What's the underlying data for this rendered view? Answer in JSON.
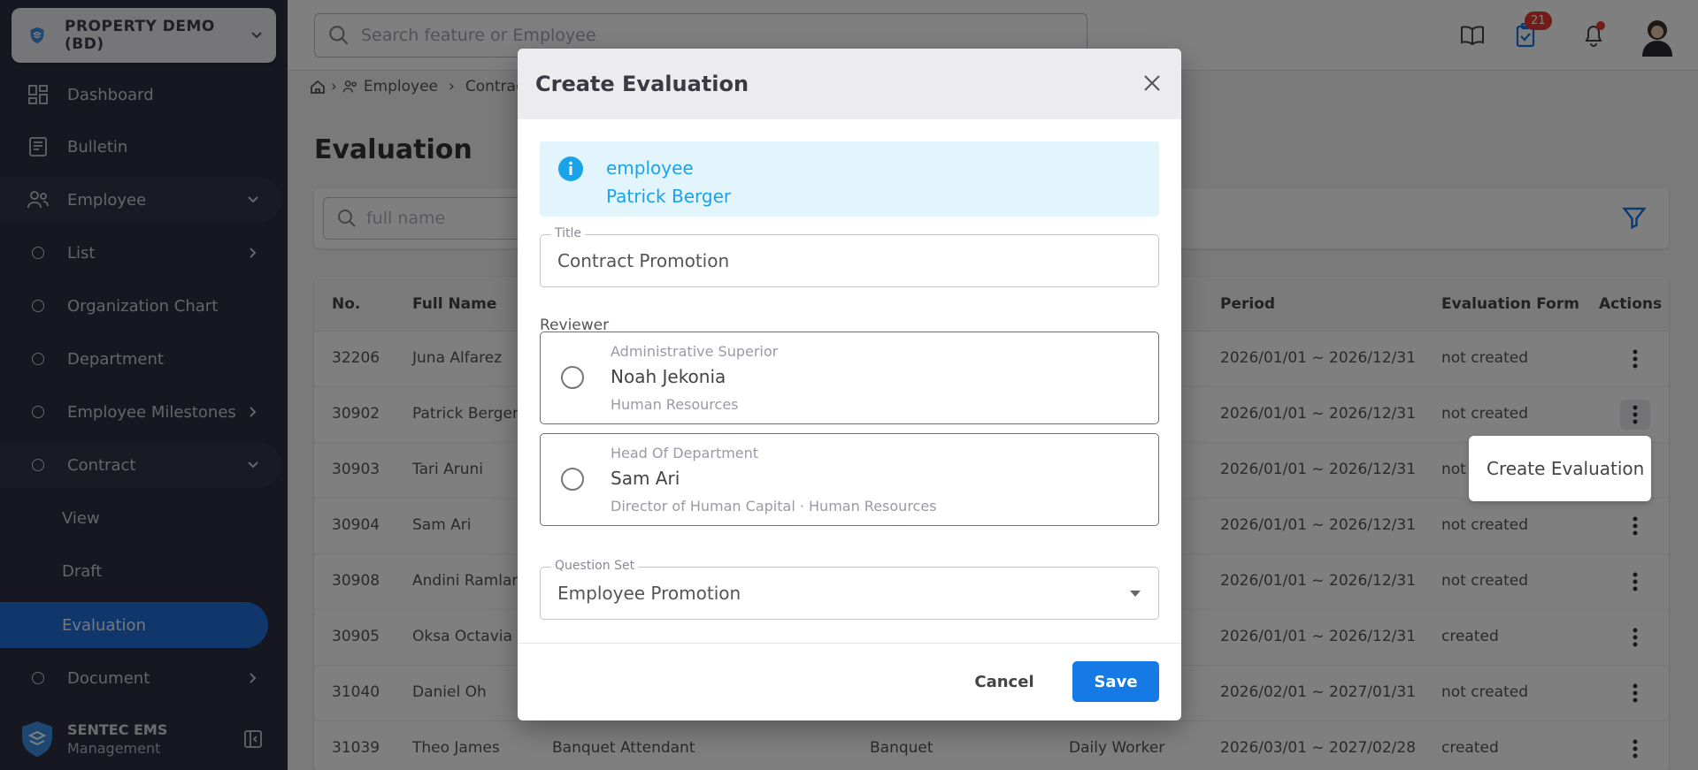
{
  "sidebar": {
    "company": "PROPERTY DEMO (BD)",
    "items": [
      {
        "label": "Dashboard"
      },
      {
        "label": "Bulletin"
      },
      {
        "label": "Employee"
      },
      {
        "label": "List"
      },
      {
        "label": "Organization Chart"
      },
      {
        "label": "Department"
      },
      {
        "label": "Employee Milestones"
      },
      {
        "label": "Contract"
      },
      {
        "label": "View"
      },
      {
        "label": "Draft"
      },
      {
        "label": "Evaluation"
      },
      {
        "label": "Document"
      }
    ],
    "brand_name": "SENTEC EMS",
    "brand_sub": "Management"
  },
  "topbar": {
    "search_placeholder": "Search feature or Employee",
    "task_badge": "21"
  },
  "breadcrumb": [
    "Employee",
    "Contract"
  ],
  "page": {
    "title": "Evaluation",
    "filter_placeholder": "full name"
  },
  "table": {
    "columns": {
      "no": "No.",
      "full_name": "Full Name",
      "period": "Period",
      "form": "Evaluation Form",
      "actions": "Actions"
    },
    "rows": [
      {
        "no": "32206",
        "name": "Juna Alfarez",
        "position": "",
        "dept": "",
        "type": "",
        "period": "2026/01/01 ~ 2026/12/31",
        "form": "not created"
      },
      {
        "no": "30902",
        "name": "Patrick Berger",
        "position": "",
        "dept": "",
        "type": "",
        "period": "2026/01/01 ~ 2026/12/31",
        "form": "not created"
      },
      {
        "no": "30903",
        "name": "Tari Aruni",
        "position": "",
        "dept": "",
        "type": "",
        "period": "2026/01/01 ~ 2026/12/31",
        "form": "not"
      },
      {
        "no": "30904",
        "name": "Sam Ari",
        "position": "",
        "dept": "",
        "type": "",
        "period": "2026/01/01 ~ 2026/12/31",
        "form": "not created"
      },
      {
        "no": "30908",
        "name": "Andini Ramlan",
        "position": "",
        "dept": "",
        "type": "",
        "period": "2026/01/01 ~ 2026/12/31",
        "form": "not created"
      },
      {
        "no": "30905",
        "name": "Oksa Octavia",
        "position": "",
        "dept": "",
        "type": "",
        "period": "2026/01/01 ~ 2026/12/31",
        "form": "created"
      },
      {
        "no": "31040",
        "name": "Daniel Oh",
        "position": "",
        "dept": "",
        "type": "",
        "period": "2026/02/01 ~ 2027/01/31",
        "form": "not created"
      },
      {
        "no": "31039",
        "name": "Theo James",
        "position": "Banquet Attendant",
        "dept": "Banquet",
        "type": "Daily Worker",
        "period": "2026/03/01 ~ 2027/02/28",
        "form": "created"
      }
    ]
  },
  "row_menu": {
    "create_evaluation": "Create Evaluation"
  },
  "modal": {
    "title": "Create Evaluation",
    "info_label": "employee",
    "info_value": "Patrick Berger",
    "title_field": {
      "label": "Title",
      "value": "Contract Promotion"
    },
    "reviewer_label": "Reviewer",
    "reviewers": [
      {
        "role": "Administrative Superior",
        "name": "Noah Jekonia",
        "dept": "Human Resources"
      },
      {
        "role": "Head Of Department",
        "name": "Sam Ari",
        "dept": "Director of Human Capital · Human Resources"
      }
    ],
    "question_set": {
      "label": "Question Set",
      "value": "Employee Promotion"
    },
    "cancel": "Cancel",
    "save": "Save"
  },
  "colors": {
    "accent": "#1579e6",
    "sidebar_bg": "#2f2f43",
    "active_nav": "#1e6fd9",
    "info_text": "#1aa3e8",
    "badge": "#e53935"
  }
}
